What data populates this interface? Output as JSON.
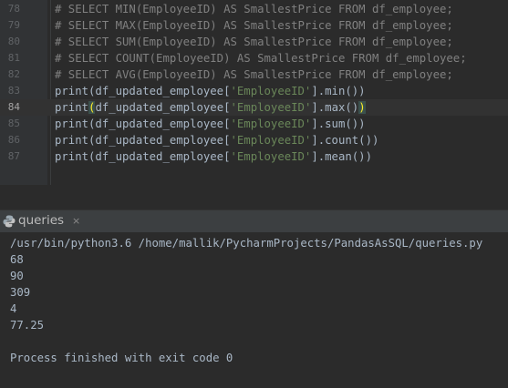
{
  "editor": {
    "lines": [
      {
        "no": "78",
        "parts": [
          {
            "t": "# SELECT MIN(EmployeeID) AS SmallestPrice FROM df_employee;",
            "c": "comment"
          }
        ]
      },
      {
        "no": "79",
        "parts": [
          {
            "t": "# SELECT MAX(EmployeeID) AS SmallestPrice FROM df_employee;",
            "c": "comment"
          }
        ]
      },
      {
        "no": "80",
        "parts": [
          {
            "t": "# SELECT SUM(EmployeeID) AS SmallestPrice FROM df_employee;",
            "c": "comment"
          }
        ]
      },
      {
        "no": "81",
        "parts": [
          {
            "t": "# SELECT COUNT(EmployeeID) AS SmallestPrice FROM df_employee;",
            "c": "comment"
          }
        ]
      },
      {
        "no": "82",
        "parts": [
          {
            "t": "# SELECT AVG(EmployeeID) AS SmallestPrice FROM df_employee;",
            "c": "comment"
          }
        ]
      },
      {
        "no": "83",
        "parts": [
          {
            "t": "print(df_updated_employee[",
            "c": ""
          },
          {
            "t": "'EmployeeID'",
            "c": "str"
          },
          {
            "t": "].min())",
            "c": ""
          }
        ]
      },
      {
        "no": "84",
        "current": true,
        "parts": [
          {
            "t": "print",
            "c": ""
          },
          {
            "t": "(",
            "c": "brace-hl"
          },
          {
            "t": "df_updated_employee[",
            "c": ""
          },
          {
            "t": "'EmployeeID'",
            "c": "str"
          },
          {
            "t": "].max()",
            "c": ""
          },
          {
            "t": ")",
            "c": "brace-hl"
          }
        ]
      },
      {
        "no": "85",
        "parts": [
          {
            "t": "print(df_updated_employee[",
            "c": ""
          },
          {
            "t": "'EmployeeID'",
            "c": "str"
          },
          {
            "t": "].sum())",
            "c": ""
          }
        ]
      },
      {
        "no": "86",
        "parts": [
          {
            "t": "print(df_updated_employee[",
            "c": ""
          },
          {
            "t": "'EmployeeID'",
            "c": "str"
          },
          {
            "t": "].count())",
            "c": ""
          }
        ]
      },
      {
        "no": "87",
        "parts": [
          {
            "t": "print(df_updated_employee[",
            "c": ""
          },
          {
            "t": "'EmployeeID'",
            "c": "str"
          },
          {
            "t": "].mean())",
            "c": ""
          }
        ]
      }
    ]
  },
  "run_panel": {
    "tab_title": "queries",
    "close_glyph": "×",
    "icon": "python-icon"
  },
  "console": {
    "lines": [
      "/usr/bin/python3.6 /home/mallik/PycharmProjects/PandasAsSQL/queries.py",
      "68",
      "90",
      "309",
      "4",
      "77.25",
      "",
      "Process finished with exit code 0"
    ]
  },
  "colors": {
    "editor_bg": "#2b2b2b",
    "comment": "#808080",
    "string": "#6a8759",
    "text": "#a9b7c6"
  }
}
